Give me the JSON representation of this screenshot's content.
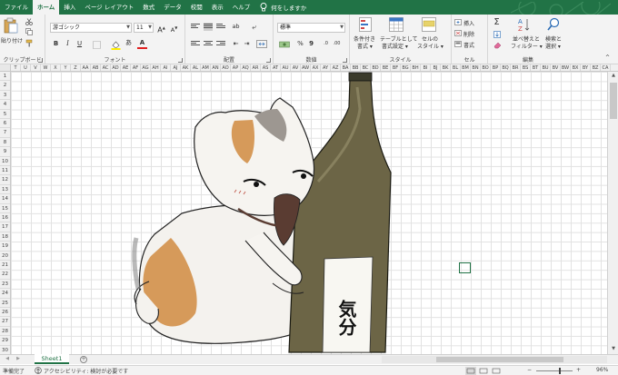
{
  "ribbon_tabs": [
    "ファイル",
    "ホーム",
    "挿入",
    "ページ レイアウト",
    "数式",
    "データ",
    "校閲",
    "表示",
    "ヘルプ"
  ],
  "tell_me": "何をしますか",
  "clipboard": {
    "paste_label": "貼り付け",
    "group_label": "クリップボード"
  },
  "font": {
    "name": "游ゴシック",
    "size": "11",
    "grow": "A",
    "shrink": "A",
    "bold": "B",
    "italic": "I",
    "underline": "U",
    "font_color": "A",
    "highlight": "あ",
    "group_label": "フォント"
  },
  "alignment": {
    "group_label": "配置"
  },
  "number": {
    "format": "標準",
    "percent": "%",
    "comma": "9",
    "group_label": "数値"
  },
  "styles": {
    "conditional": [
      "条件付き",
      "書式 ▾"
    ],
    "table": [
      "テーブルとして",
      "書式設定 ▾"
    ],
    "cell": [
      "セルの",
      "スタイル ▾"
    ],
    "group_label": "スタイル"
  },
  "cells": {
    "insert": "挿入",
    "delete": "削除",
    "format": "書式",
    "group_label": "セル"
  },
  "editing": {
    "sum": "Σ",
    "sort": [
      "並べ替えと",
      "フィルター ▾"
    ],
    "find": [
      "検索と",
      "選択 ▾"
    ],
    "group_label": "編集"
  },
  "columns": [
    "T",
    "U",
    "V",
    "W",
    "X",
    "Y",
    "Z",
    "AA",
    "AB",
    "AC",
    "AD",
    "AE",
    "AF",
    "AG",
    "AH",
    "AI",
    "AJ",
    "AK",
    "AL",
    "AM",
    "AN",
    "AO",
    "AP",
    "AQ",
    "AR",
    "AS",
    "AT",
    "AU",
    "AV",
    "AW",
    "AX",
    "AY",
    "AZ",
    "BA",
    "BB",
    "BC",
    "BD",
    "BE",
    "BF",
    "BG",
    "BH",
    "BI",
    "BJ",
    "BK",
    "BL",
    "BM",
    "BN",
    "BO",
    "BP",
    "BQ",
    "BR",
    "BS",
    "BT",
    "BU",
    "BV",
    "BW",
    "BX",
    "BY",
    "BZ",
    "CA"
  ],
  "rows": [
    "1",
    "2",
    "3",
    "4",
    "5",
    "6",
    "7",
    "8",
    "9",
    "10",
    "11",
    "12",
    "13",
    "14",
    "15",
    "16",
    "17",
    "18",
    "19",
    "20",
    "21",
    "22",
    "23",
    "24",
    "25",
    "26",
    "27",
    "28",
    "29",
    "30"
  ],
  "artwork_label": "気分",
  "sheet_tab": "Sheet1",
  "add_sheet": "+",
  "status": {
    "ready": "準備完了",
    "accessibility": "アクセシビリティ: 検討が必要です",
    "zoom": "96%"
  },
  "colors": {
    "accent": "#217346",
    "ribbon": "#f3f3f3"
  }
}
